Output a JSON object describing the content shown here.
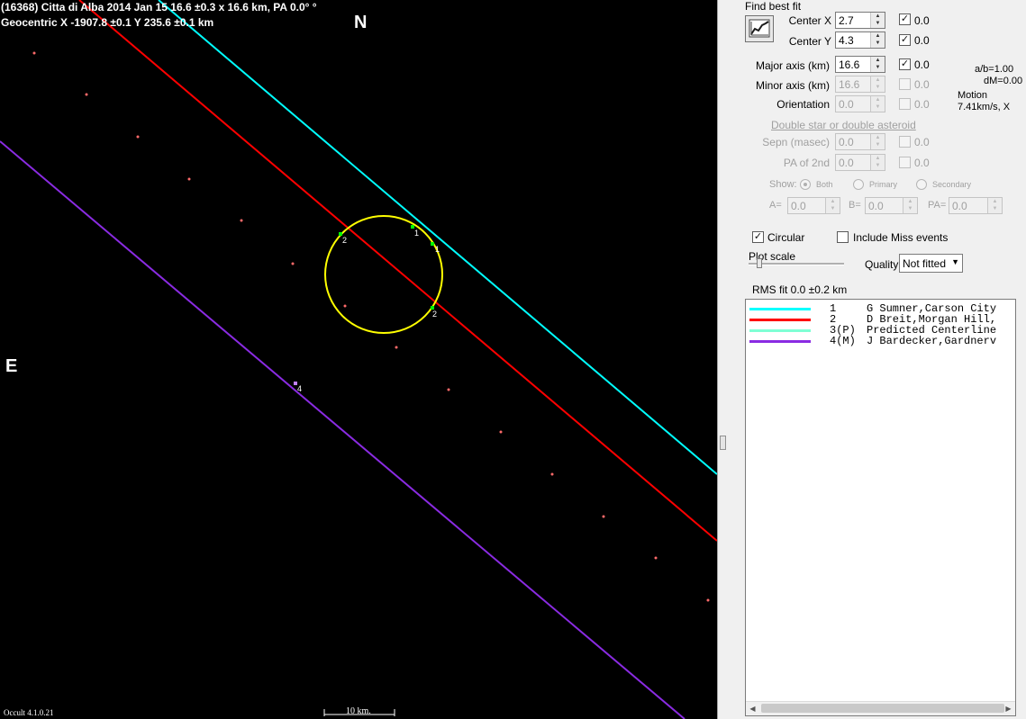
{
  "plot": {
    "title_line1": "(16368) Citta di Alba  2014 Jan 15   16.6 ±0.3 x 16.6 km, PA 0.0° °",
    "title_line2": "Geocentric  X  -1907.8 ±0.1  Y 235.6 ±0.1 km",
    "north_label": "N",
    "east_label": "E",
    "version": "Occult 4.1.0.21",
    "scale_label": "10 km.",
    "chord_colors": {
      "chord1": "#00ffff",
      "chord2": "#ff0000",
      "chord4": "#8a2be2",
      "ellipse": "#ffff00",
      "path_dots": "#ff6a6a"
    },
    "markers": {
      "m1a": "1",
      "m1b": "1",
      "m2a": "2",
      "m2b": "2",
      "m4": "4"
    }
  },
  "panel": {
    "find_best_fit": "Find best fit",
    "fit_icon": "chart-fit-icon",
    "center_x": {
      "label": "Center X",
      "value": "2.7",
      "checked": true,
      "delta": "0.0"
    },
    "center_y": {
      "label": "Center Y",
      "value": "4.3",
      "checked": true,
      "delta": "0.0"
    },
    "major_axis": {
      "label": "Major axis (km)",
      "value": "16.6",
      "checked": true,
      "delta": "0.0"
    },
    "minor_axis": {
      "label": "Minor axis (km)",
      "value": "16.6",
      "checked": false,
      "delta": "0.0"
    },
    "orientation": {
      "label": "Orientation",
      "value": "0.0",
      "checked": false,
      "delta": "0.0"
    },
    "ab_ratio": "a/b=1.00",
    "dm": "dM=0.00",
    "motion_label": "Motion",
    "motion_value": "7.41km/s, X",
    "double_star_link": "Double star  or  double asteroid",
    "sepn": {
      "label": "Sepn (masec)",
      "value": "0.0",
      "delta": "0.0"
    },
    "pa_2nd": {
      "label": "PA of 2nd",
      "value": "0.0",
      "delta": "0.0"
    },
    "show_label": "Show:",
    "show_options": [
      "Both",
      "Primary",
      "Secondary"
    ],
    "a_label": "A=",
    "a_value": "0.0",
    "b_label": "B=",
    "b_value": "0.0",
    "pa_label": "PA=",
    "pa_value": "0.0",
    "circular_label": "Circular",
    "circular_checked": true,
    "include_miss_label": "Include Miss events",
    "include_miss_checked": false,
    "plot_scale_label": "Plot scale",
    "quality_label": "Quality",
    "quality_value": "Not fitted",
    "rms_fit": "RMS fit 0.0 ±0.2 km"
  },
  "chords": [
    {
      "num": "1",
      "name": "G Sumner,Carson City",
      "color": "#00ffff"
    },
    {
      "num": "2",
      "name": "D Breit,Morgan Hill,",
      "color": "#ff0000"
    },
    {
      "num": "3(P)",
      "name": "Predicted Centerline",
      "color": "#7fffd4"
    },
    {
      "num": "4(M)",
      "name": "J Bardecker,Gardnerv",
      "color": "#8a2be2"
    }
  ]
}
